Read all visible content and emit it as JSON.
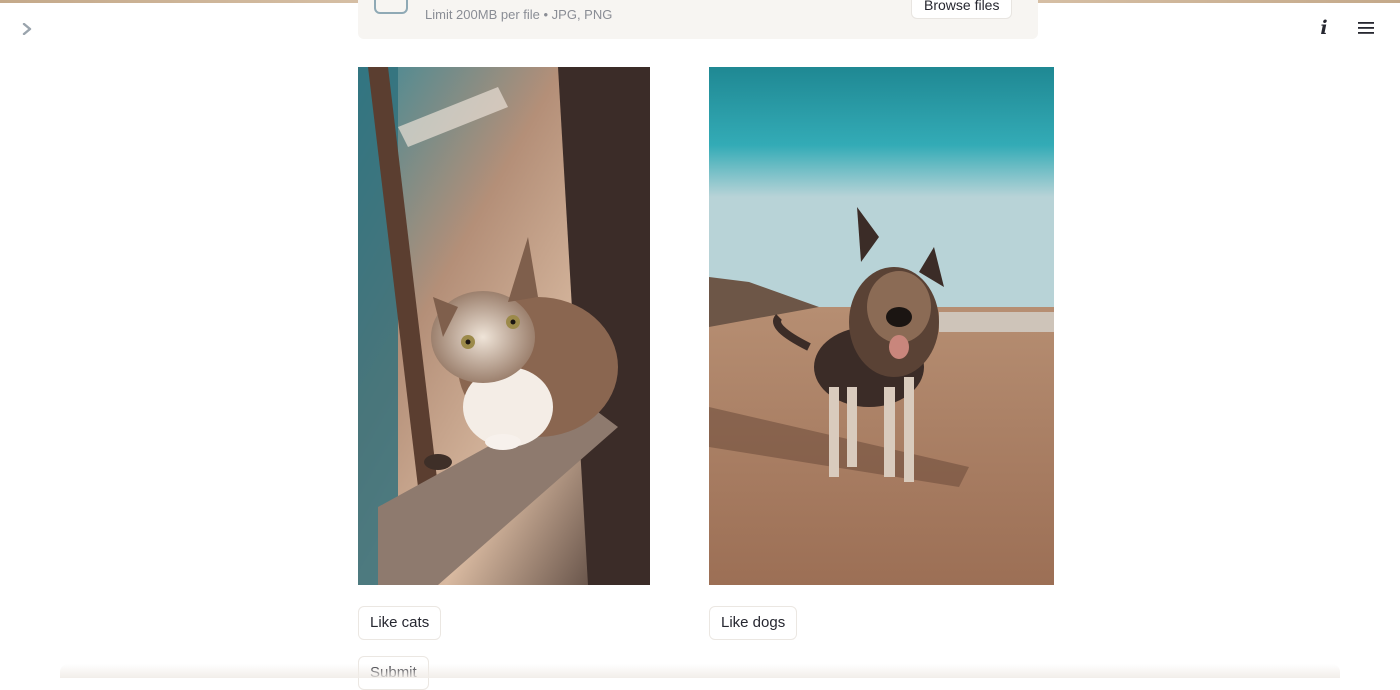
{
  "uploader": {
    "limit_text": "Limit 200MB per file • JPG, PNG",
    "browse_label": "Browse files",
    "icon": "upload-cloud-icon"
  },
  "header": {
    "sidebar_icon": "chevron-right-icon",
    "info_icon": "info-icon",
    "info_glyph": "i",
    "menu_icon": "hamburger-menu-icon"
  },
  "main": {
    "images": [
      {
        "subject": "cat"
      },
      {
        "subject": "dog"
      }
    ],
    "buttons": {
      "like_cats": "Like cats",
      "like_dogs": "Like dogs",
      "submit": "Submit"
    }
  },
  "colors": {
    "text": "#262730",
    "button_border": "#ebe7e2",
    "top_accent": "#c4a98a"
  }
}
